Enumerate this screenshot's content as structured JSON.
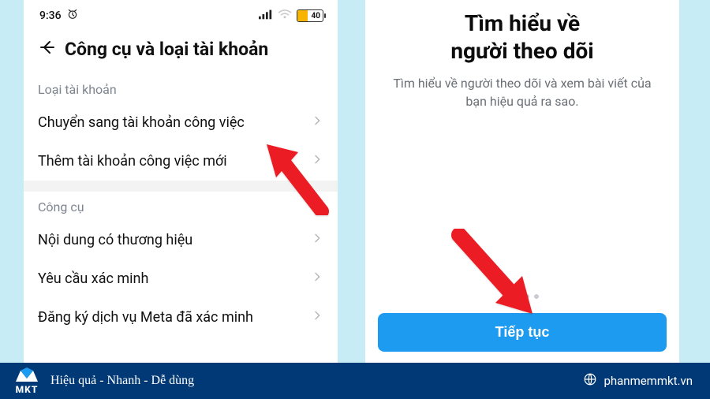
{
  "statusbar": {
    "time": "9:36",
    "battery": "40",
    "battery_pct": 40
  },
  "left": {
    "title": "Công cụ và loại tài khoản",
    "section1_label": "Loại tài khoản",
    "row_switch": "Chuyển sang tài khoản công việc",
    "row_add": "Thêm tài khoản công việc mới",
    "section2_label": "Công cụ",
    "row_brand": "Nội dung có thương hiệu",
    "row_verify": "Yêu cầu xác minh",
    "row_meta": "Đăng ký dịch vụ Meta đã xác minh"
  },
  "right": {
    "title_l1": "Tìm hiểu về",
    "title_l2": "người theo dõi",
    "subtitle": "Tìm hiểu về người theo dõi và xem bài viết của bạn hiệu quả ra sao.",
    "cta": "Tiếp tục"
  },
  "footer": {
    "brand": "MKT",
    "tagline": "Hiệu quả - Nhanh - Dễ dùng",
    "domain": "phanmemmkt.vn"
  },
  "icons": {
    "back": "back-arrow-icon",
    "chevron": "chevron-right-icon",
    "alarm": "alarm-icon",
    "signal": "signal-icon",
    "wifi": "wifi-icon",
    "globe": "globe-icon"
  }
}
